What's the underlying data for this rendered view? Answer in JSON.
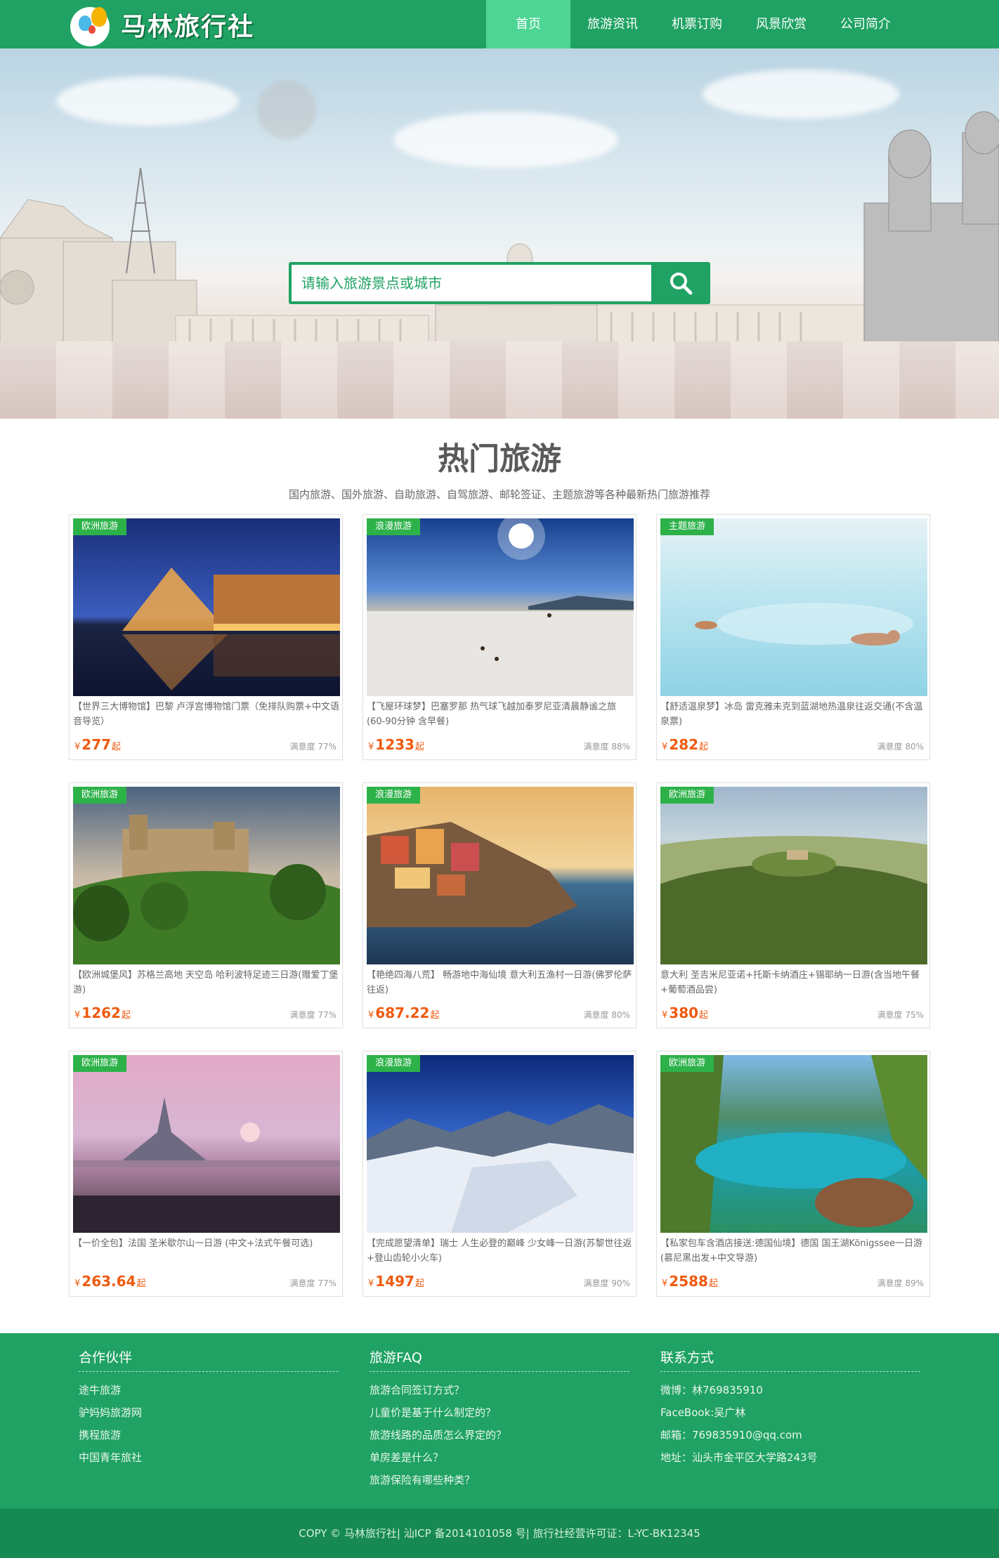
{
  "site": {
    "logo_text": "马林旅行社",
    "brand_color": "#1fa263",
    "nav_active_color": "#4ed594",
    "tag_color": "#2db24a",
    "price_color": "#ef5a10"
  },
  "nav": [
    {
      "label": "首页",
      "active": true
    },
    {
      "label": "旅游资讯",
      "active": false
    },
    {
      "label": "机票订购",
      "active": false
    },
    {
      "label": "风景欣赏",
      "active": false
    },
    {
      "label": "公司简介",
      "active": false
    }
  ],
  "search": {
    "placeholder": "请输入旅游景点或城市",
    "button_icon": "search-icon"
  },
  "hot": {
    "title": "热门旅游",
    "subtitle": "国内旅游、国外旅游、自助旅游、自驾旅游、邮轮签证、主题旅游等各种最新热门旅游推荐",
    "currency": "¥",
    "price_suffix": "起",
    "cards": [
      {
        "tag": "欧洲旅游",
        "desc": "【世界三大博物馆】巴黎 卢浮宫博物馆门票（免排队购票+中文语音导览）",
        "price": "277",
        "sat": "满意度 77%"
      },
      {
        "tag": "浪漫旅游",
        "desc": "【飞屋环球梦】巴塞罗那 热气球飞越加泰罗尼亚清晨静谧之旅(60-90分钟 含早餐)",
        "price": "1233",
        "sat": "满意度 88%"
      },
      {
        "tag": "主题旅游",
        "desc": "【舒适温泉梦】冰岛 雷克雅未克到蓝湖地热温泉往返交通(不含温泉票)",
        "price": "282",
        "sat": "满意度 80%"
      },
      {
        "tag": "欧洲旅游",
        "desc": "【欧洲城堡风】苏格兰高地 天空岛 哈利波特足迹三日游(赠爱丁堡游)",
        "price": "1262",
        "sat": "满意度 77%"
      },
      {
        "tag": "浪漫旅游",
        "desc": "【艳绝四海八荒】 畅游地中海仙境 意大利五渔村一日游(佛罗伦萨往返)",
        "price": "687.22",
        "sat": "满意度 80%"
      },
      {
        "tag": "欧洲旅游",
        "desc": "意大利 圣吉米尼亚诺+托斯卡纳酒庄+锡耶纳一日游(含当地午餐+葡萄酒品尝)",
        "price": "380",
        "sat": "满意度 75%"
      },
      {
        "tag": "欧洲旅游",
        "desc": "【一价全包】法国 圣米歇尔山一日游 (中文+法式午餐可选)",
        "price": "263.64",
        "sat": "满意度 77%"
      },
      {
        "tag": "浪漫旅游",
        "desc": "【完成愿望清单】瑞士 人生必登的巅峰 少女峰一日游(苏黎世往返+登山齿轮小火车)",
        "price": "1497",
        "sat": "满意度 90%"
      },
      {
        "tag": "欧洲旅游",
        "desc": "【私家包车含酒店接送:德国仙境】德国 国王湖Königssee一日游(慕尼黑出发+中文导游)",
        "price": "2588",
        "sat": "满意度 89%"
      }
    ]
  },
  "footer": {
    "columns": [
      {
        "title": "合作伙伴",
        "links": [
          "途牛旅游",
          "驴妈妈旅游网",
          "携程旅游",
          "中国青年旅社"
        ]
      },
      {
        "title": "旅游FAQ",
        "links": [
          "旅游合同签订方式？",
          "儿童价是基于什么制定的？",
          "旅游线路的品质怎么界定的？",
          "单房差是什么？",
          "旅游保险有哪些种类？"
        ]
      },
      {
        "title": "联系方式",
        "links": [
          "微博：林769835910",
          "FaceBook:吴广林",
          "邮箱：769835910@qq.com",
          "地址：汕头市金平区大学路243号"
        ]
      }
    ],
    "copyright": "COPY © 马林旅行社| 汕ICP 备2014101058 号| 旅行社经营许可证：L-YC-BK12345"
  }
}
